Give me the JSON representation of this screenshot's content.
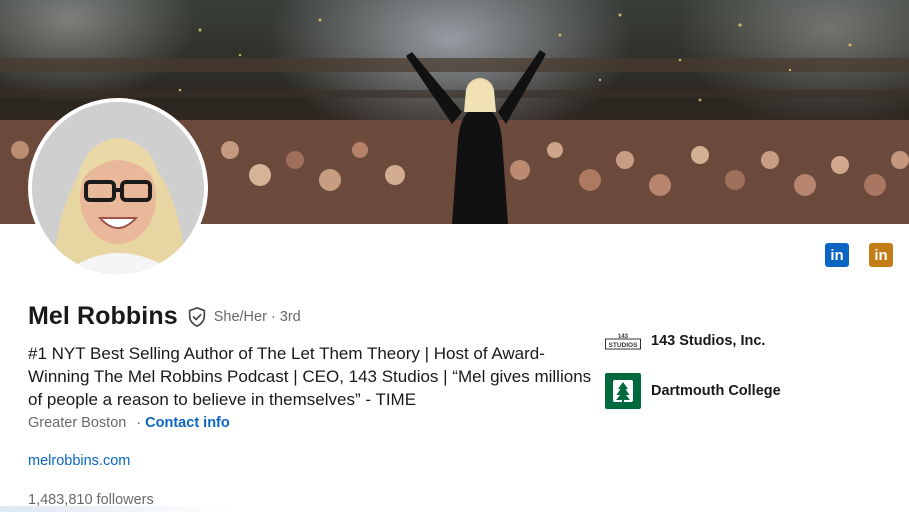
{
  "profile": {
    "name": "Mel Robbins",
    "pronouns": "She/Her",
    "separator": "·",
    "degree": "3rd",
    "headline": "#1 NYT Best Selling Author of The Let Them Theory | Host of Award-Winning The Mel Robbins Podcast | CEO, 143 Studios | “Mel gives millions of people a reason to believe in themselves” - TIME",
    "location": "Greater Boston",
    "contact_label": "Contact info",
    "website": "melrobbins.com",
    "followers": "1,483,810 followers"
  },
  "organizations": [
    {
      "name": "143 Studios, Inc.",
      "logo_text_top": "143",
      "logo_text_bottom": "STUDIOS",
      "icon": "143-studios-logo"
    },
    {
      "name": "Dartmouth College",
      "icon": "dartmouth-pine-logo"
    }
  ],
  "header_actions": [
    {
      "label": "in",
      "icon": "linkedin-icon",
      "color": "#0a66c2"
    },
    {
      "label": "in",
      "icon": "linkedin-icon",
      "color": "#c37d16"
    }
  ],
  "colors": {
    "link": "#0a66c2",
    "dartmouth_green": "#00693e",
    "muted_text": "rgba(0,0,0,0.6)"
  }
}
